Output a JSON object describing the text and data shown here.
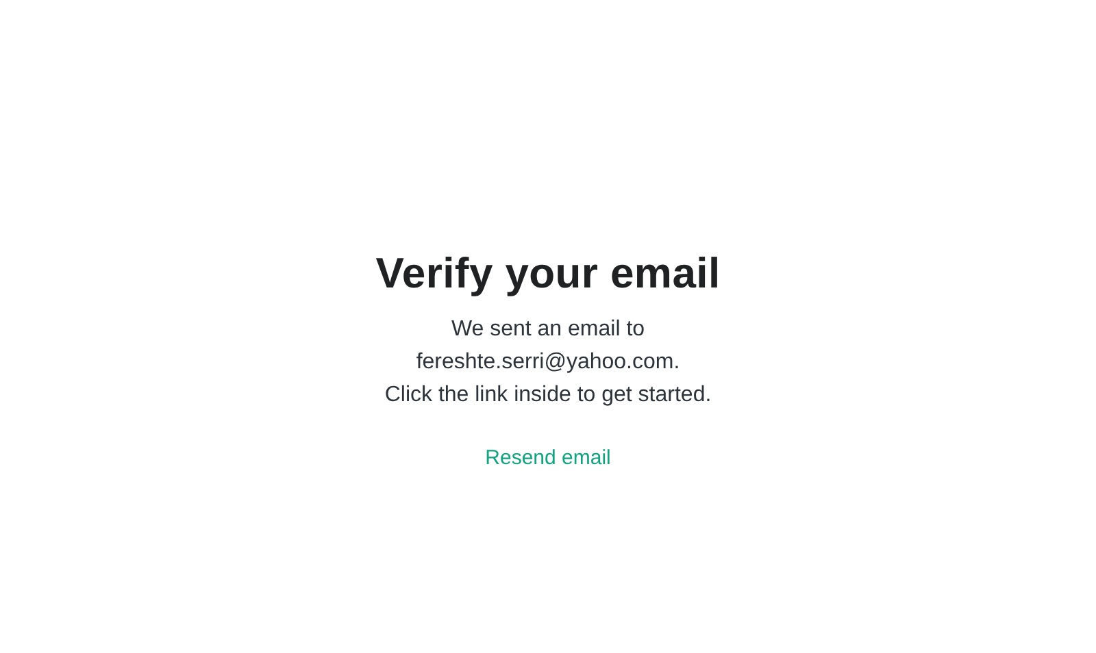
{
  "title": "Verify your email",
  "message_lines": [
    "We sent an email to",
    "fereshte.serri@yahoo.com.",
    "Click the link inside to get started."
  ],
  "link": {
    "label": "Resend email"
  }
}
